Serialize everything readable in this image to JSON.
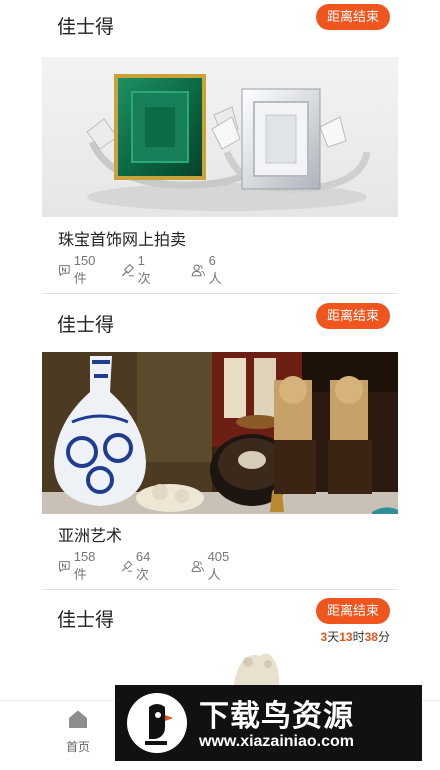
{
  "cards": [
    {
      "house": "佳士得",
      "badge": "距离结束",
      "title": "珠宝首饰网上拍卖",
      "stats": {
        "lots": "150件",
        "bids": "1次",
        "people": "6人"
      },
      "image_subject": "emerald and diamond rings"
    },
    {
      "house": "佳士得",
      "badge": "距离结束",
      "title": "亚洲艺术",
      "stats": {
        "lots": "158件",
        "bids": "64次",
        "people": "405人"
      },
      "image_subject": "blue and white porcelain, jade and foo dogs"
    },
    {
      "house": "佳士得",
      "badge": "距离结束",
      "countdown": {
        "days": "3",
        "days_unit": "天",
        "hours": "13",
        "hours_unit": "时",
        "minutes": "38",
        "minutes_unit": "分"
      },
      "image_subject": "jade carving"
    }
  ],
  "tabbar": {
    "home_label": "首页",
    "home_icon": "home-icon"
  },
  "watermark": {
    "title": "下载鸟资源",
    "url": "www.xiazainiao.com",
    "logo_icon": "bird-logo-icon"
  },
  "colors": {
    "accent": "#f0551e",
    "countdown_number": "#e8541c",
    "divider": "#e2e2e2"
  }
}
